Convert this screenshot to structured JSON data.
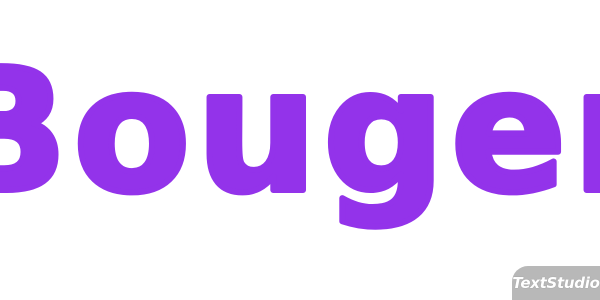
{
  "headline": {
    "text": "Bouger",
    "color": "#9333ea"
  },
  "watermark": {
    "text": "TextStudio",
    "background": "#b8b8b8",
    "color": "#ffffff"
  }
}
